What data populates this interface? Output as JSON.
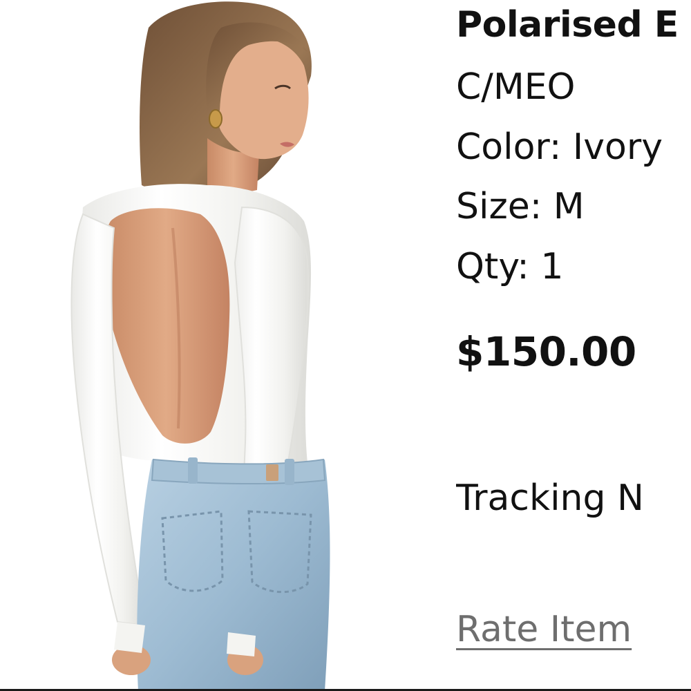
{
  "order_item": {
    "product_name": "Polarised E",
    "brand": "C/MEO",
    "color_line": "Color: Ivory",
    "size_line": "Size: M",
    "qty_line": "Qty: 1",
    "price": "$150.00",
    "tracking_line": "Tracking N",
    "rate_item_label": "Rate Item"
  },
  "image": {
    "subject": "model wearing ivory open-back long-sleeve top with light-wash jeans"
  },
  "colors": {
    "text": "#111111",
    "link": "#6e6e6e",
    "top_fabric": "#f4f4f1",
    "denim": "#a9c4d8",
    "hair": "#8a6a4c",
    "skin": "#d9a27e"
  }
}
